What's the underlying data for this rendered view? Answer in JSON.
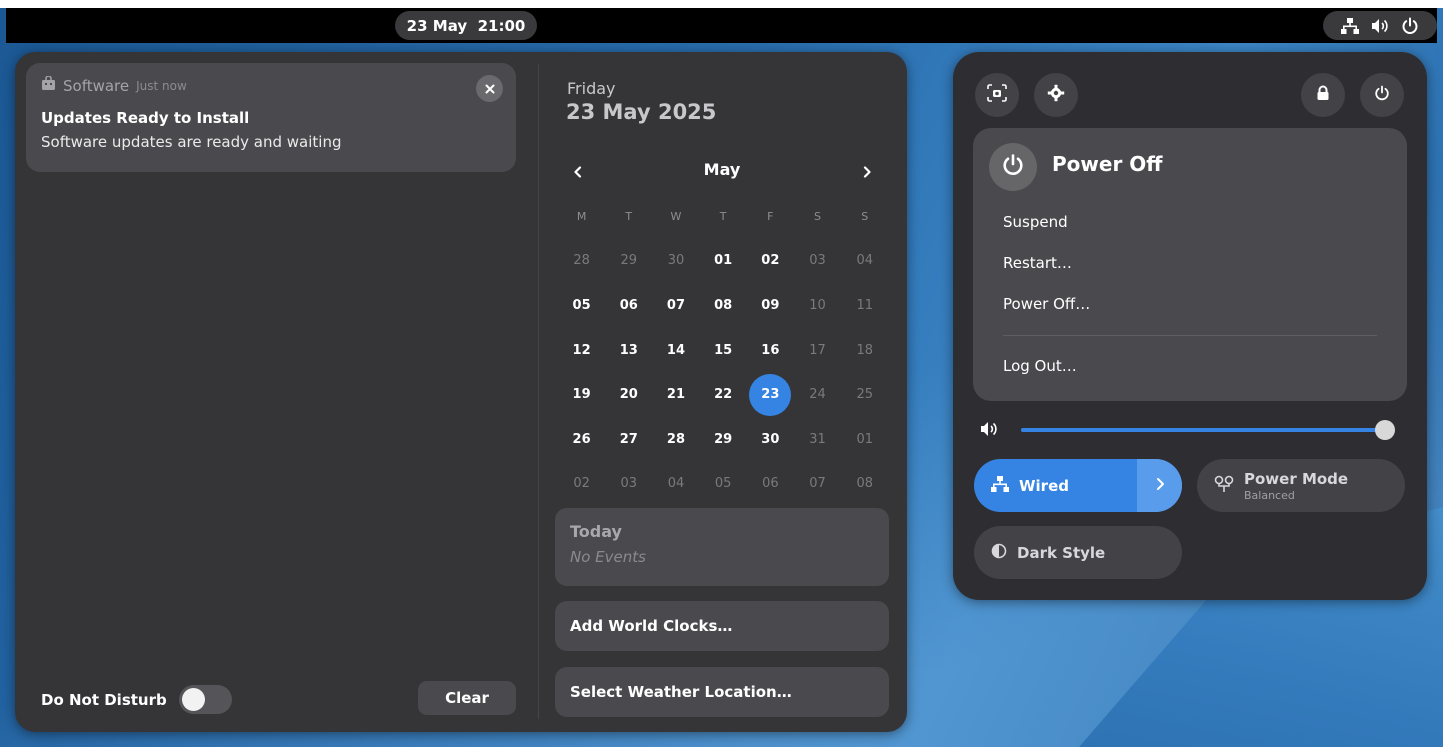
{
  "top_bar": {
    "clock": "23 May  21:00",
    "icons": [
      "network-wired-icon",
      "volume-icon",
      "power-icon"
    ]
  },
  "notification": {
    "app_name": "Software",
    "time": "Just now",
    "title": "Updates Ready to Install",
    "body": "Software updates are ready and waiting",
    "app_icon": "software-bag-icon",
    "close_icon": "close-icon"
  },
  "do_not_disturb": {
    "label": "Do Not Disturb",
    "enabled": false
  },
  "clear_button": "Clear",
  "calendar": {
    "weekday": "Friday",
    "full_date": "23 May 2025",
    "month": "May",
    "weekday_headers": [
      "M",
      "T",
      "W",
      "T",
      "F",
      "S",
      "S"
    ],
    "weeks": [
      [
        "28",
        "29",
        "30",
        "01",
        "02",
        "03",
        "04"
      ],
      [
        "05",
        "06",
        "07",
        "08",
        "09",
        "10",
        "11"
      ],
      [
        "12",
        "13",
        "14",
        "15",
        "16",
        "17",
        "18"
      ],
      [
        "19",
        "20",
        "21",
        "22",
        "23",
        "24",
        "25"
      ],
      [
        "26",
        "27",
        "28",
        "29",
        "30",
        "31",
        "01"
      ],
      [
        "02",
        "03",
        "04",
        "05",
        "06",
        "07",
        "08"
      ]
    ],
    "today": "23"
  },
  "events": {
    "title": "Today",
    "empty_text": "No Events"
  },
  "world_clocks_button": "Add World Clocks…",
  "weather_button": "Select Weather Location…",
  "quick_settings": {
    "top_buttons": [
      "screenshot-icon",
      "settings-icon",
      "lock-icon",
      "power-icon"
    ],
    "power_menu": {
      "title": "Power Off",
      "items": [
        "Suspend",
        "Restart…",
        "Power Off…"
      ],
      "logout": "Log Out…"
    },
    "volume_level": 0.99,
    "wired": {
      "label": "Wired",
      "active": true
    },
    "power_mode": {
      "label": "Power Mode",
      "value": "Balanced"
    },
    "dark_style": {
      "label": "Dark Style"
    }
  },
  "colors": {
    "accent": "#3584e4",
    "panel_bg": "#353538",
    "card_bg": "#4a4a4e",
    "quick_settings_bg": "#2e2e32"
  }
}
